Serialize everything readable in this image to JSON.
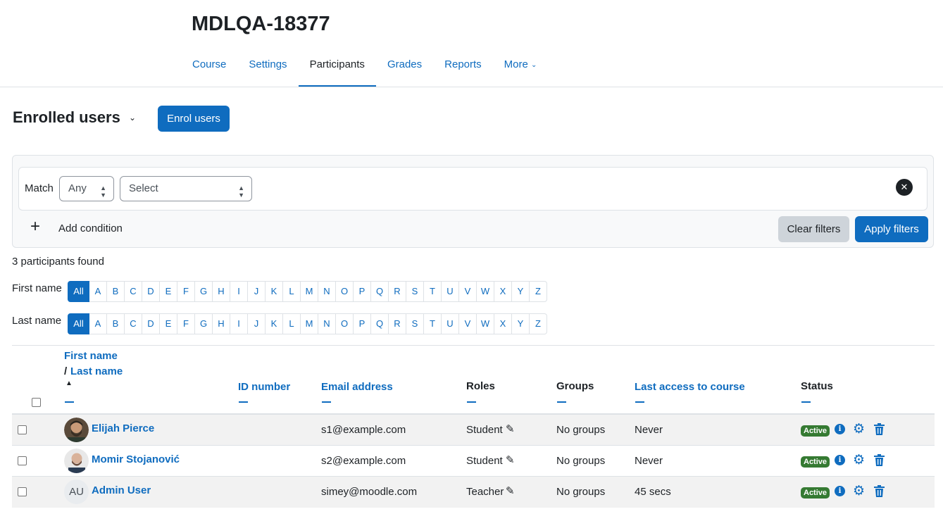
{
  "course": {
    "title": "MDLQA-18377",
    "nav": [
      {
        "label": "Course",
        "active": false
      },
      {
        "label": "Settings",
        "active": false
      },
      {
        "label": "Participants",
        "active": true
      },
      {
        "label": "Grades",
        "active": false
      },
      {
        "label": "Reports",
        "active": false
      },
      {
        "label": "More",
        "active": false
      }
    ]
  },
  "page": {
    "heading": "Enrolled users",
    "enrol_button": "Enrol users"
  },
  "filter": {
    "match_label": "Match",
    "match_value": "Any",
    "condition_value": "Select",
    "add_condition": "Add condition",
    "clear_button": "Clear filters",
    "apply_button": "Apply filters"
  },
  "participants_found": "3 participants found",
  "initials": {
    "first_label": "First name",
    "last_label": "Last name",
    "all": "All",
    "letters": [
      "A",
      "B",
      "C",
      "D",
      "E",
      "F",
      "G",
      "H",
      "I",
      "J",
      "K",
      "L",
      "M",
      "N",
      "O",
      "P",
      "Q",
      "R",
      "S",
      "T",
      "U",
      "V",
      "W",
      "X",
      "Y",
      "Z"
    ]
  },
  "table": {
    "headers": {
      "first_name": "First name",
      "slash": "/",
      "last_name": "Last name",
      "id_number": "ID number",
      "email": "Email address",
      "roles": "Roles",
      "groups": "Groups",
      "last_access": "Last access to course",
      "status": "Status"
    },
    "rows": [
      {
        "name": "Elijah Pierce",
        "email": "s1@example.com",
        "role": "Student",
        "groups": "No groups",
        "last_access": "Never",
        "status": "Active",
        "avatar": "photo-1"
      },
      {
        "name": "Momir Stojanović",
        "email": "s2@example.com",
        "role": "Student",
        "groups": "No groups",
        "last_access": "Never",
        "status": "Active",
        "avatar": "photo-2"
      },
      {
        "name": "Admin User",
        "email": "simey@moodle.com",
        "role": "Teacher",
        "groups": "No groups",
        "last_access": "45 secs",
        "status": "Active",
        "avatar_initials": "AU"
      }
    ]
  },
  "colors": {
    "brand": "#0f6cbf",
    "active_badge": "#357a32",
    "secondary_button": "#ced4da"
  }
}
